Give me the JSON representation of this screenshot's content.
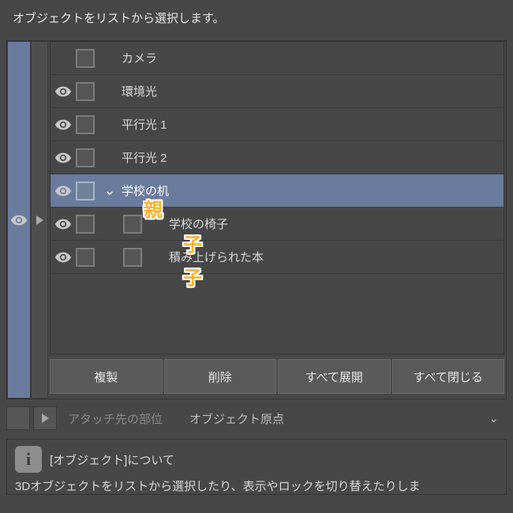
{
  "title": "オブジェクトをリストから選択します。",
  "rows": [
    {
      "visible": false,
      "label": "カメラ",
      "depth": 0,
      "expand": false,
      "selected": false
    },
    {
      "visible": true,
      "label": "環境光",
      "depth": 0,
      "expand": false,
      "selected": false
    },
    {
      "visible": true,
      "label": "平行光 1",
      "depth": 0,
      "expand": false,
      "selected": false
    },
    {
      "visible": true,
      "label": "平行光 2",
      "depth": 0,
      "expand": false,
      "selected": false
    },
    {
      "visible": true,
      "label": "学校の机",
      "depth": 0,
      "expand": true,
      "selected": true
    },
    {
      "visible": true,
      "label": "学校の椅子",
      "depth": 1,
      "extraCb": true,
      "selected": false
    },
    {
      "visible": true,
      "label": "積み上げられた本",
      "depth": 1,
      "extraCb": true,
      "selected": false
    }
  ],
  "annotations": {
    "parent": "親",
    "child": "子"
  },
  "buttons": {
    "duplicate": "複製",
    "delete": "削除",
    "expandAll": "すべて展開",
    "collapseAll": "すべて閉じる"
  },
  "attach": {
    "label": "アタッチ先の部位",
    "value": "オブジェクト原点"
  },
  "info": {
    "heading": "[オブジェクト]について",
    "body": "3Dオブジェクトをリストから選択したり、表示やロックを切り替えたりしま"
  }
}
